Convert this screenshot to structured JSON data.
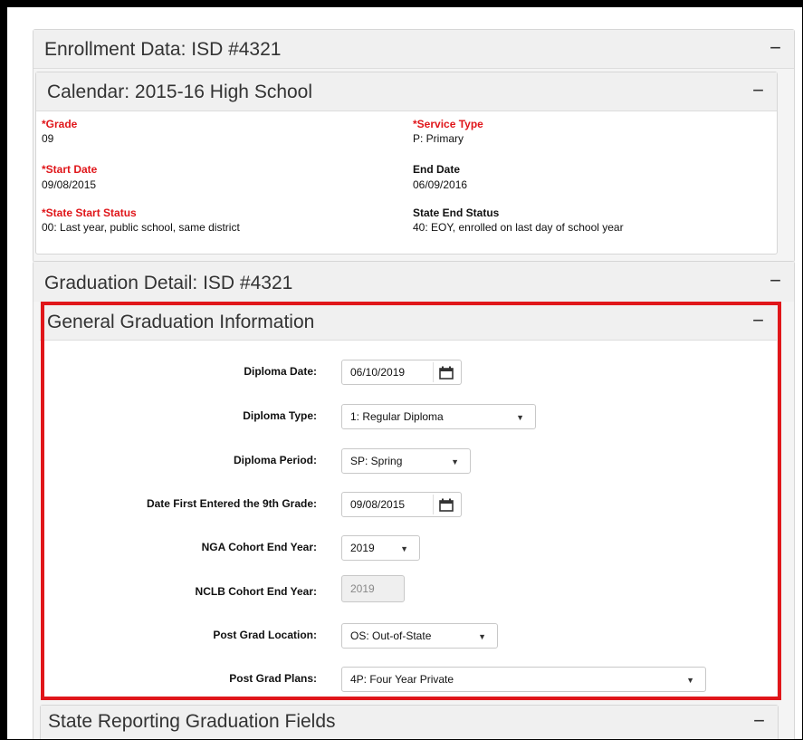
{
  "enrollment": {
    "title": "Enrollment Data: ISD #4321",
    "collapse": "−"
  },
  "calendar": {
    "title": "Calendar: 2015-16 High School",
    "collapse": "−",
    "fields": {
      "grade": {
        "label": "Grade",
        "value": "09"
      },
      "service_type": {
        "label": "Service Type",
        "value": "P: Primary"
      },
      "start_date": {
        "label": "Start Date",
        "value": "09/08/2015"
      },
      "end_date": {
        "label": "End Date",
        "value": "06/09/2016"
      },
      "state_start_status": {
        "label": "State Start Status",
        "value": "00: Last year, public school, same district"
      },
      "state_end_status": {
        "label": "State End Status",
        "value": "40: EOY, enrolled on last day of school year"
      }
    },
    "required_marker": "*"
  },
  "graduation_detail": {
    "title": "Graduation Detail: ISD #4321",
    "collapse": "−"
  },
  "general_grad": {
    "title": "General Graduation Information",
    "collapse": "−",
    "diploma_date": {
      "label": "Diploma Date:",
      "value": "06/10/2019"
    },
    "diploma_type": {
      "label": "Diploma Type:",
      "value": "1: Regular Diploma"
    },
    "diploma_period": {
      "label": "Diploma Period:",
      "value": "SP: Spring"
    },
    "date_first_9th": {
      "label": "Date First Entered the 9th Grade:",
      "value": "09/08/2015"
    },
    "nga_cohort": {
      "label": "NGA Cohort End Year:",
      "value": "2019"
    },
    "nclb_cohort": {
      "label": "NCLB Cohort End Year:",
      "value": "2019"
    },
    "post_grad_location": {
      "label": "Post Grad Location:",
      "value": "OS: Out-of-State"
    },
    "post_grad_plans": {
      "label": "Post Grad Plans:",
      "value": "4P: Four Year Private"
    }
  },
  "state_reporting": {
    "title": "State Reporting Graduation Fields",
    "collapse": "−"
  },
  "icons": {
    "calendar": "calendar-icon",
    "dropdown": "caret-down-icon",
    "collapse": "minus-icon"
  },
  "colors": {
    "required": "#e0161a",
    "highlight_border": "#e0161a"
  },
  "glyphs": {
    "caret": "▼"
  }
}
